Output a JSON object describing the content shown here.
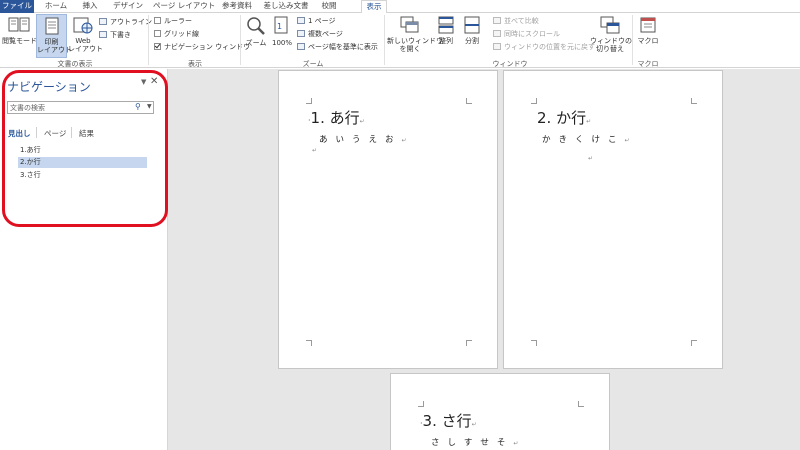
{
  "tabs": [
    "ファイル",
    "ホーム",
    "挿入",
    "デザイン",
    "ページ レイアウト",
    "参考資料",
    "差し込み文書",
    "校閲",
    "表示"
  ],
  "ribbon": {
    "doc_view": {
      "read_mode": "閲覧モード",
      "print_layout": "印刷\nレイアウト",
      "web_layout": "Web\nレイアウト",
      "outline": "アウトライン",
      "draft": "下書き",
      "label": "文書の表示"
    },
    "show": {
      "ruler": "ルーラー",
      "gridlines": "グリッド線",
      "navigation_pane": "ナビゲーション ウィンドウ",
      "label": "表示"
    },
    "zoom": {
      "zoom": "ズーム",
      "percent": "100%",
      "one_page": "1 ページ",
      "multiple_pages": "複数ページ",
      "page_width": "ページ幅を基準に表示",
      "label": "ズーム"
    },
    "window": {
      "new_window": "新しいウィンドウ\nを開く",
      "arrange": "整列",
      "split": "分割",
      "side_by_side": "並べて比較",
      "sync_scroll": "同時にスクロール",
      "reset_position": "ウィンドウの位置を元に戻す",
      "switch_windows": "ウィンドウの\n切り替え",
      "label": "ウィンドウ"
    },
    "macros": {
      "macros": "マクロ",
      "label": "マクロ"
    }
  },
  "nav": {
    "title": "ナビゲーション",
    "search_placeholder": "文書の検索",
    "tabs": [
      "見出し",
      "ページ",
      "結果"
    ],
    "headings": [
      "1.あ行",
      "2.か行",
      "3.さ行"
    ],
    "selected_index": 1
  },
  "pages": [
    {
      "heading": "1. あ行",
      "body": "あいうえお"
    },
    {
      "heading": "2. か行",
      "body": "かきくけこ"
    },
    {
      "heading": "3. さ行",
      "body": "さしすせそ"
    }
  ],
  "colors": {
    "accent": "#2b579a",
    "selection": "#c5d6ee",
    "highlight_ring": "#e01020"
  }
}
